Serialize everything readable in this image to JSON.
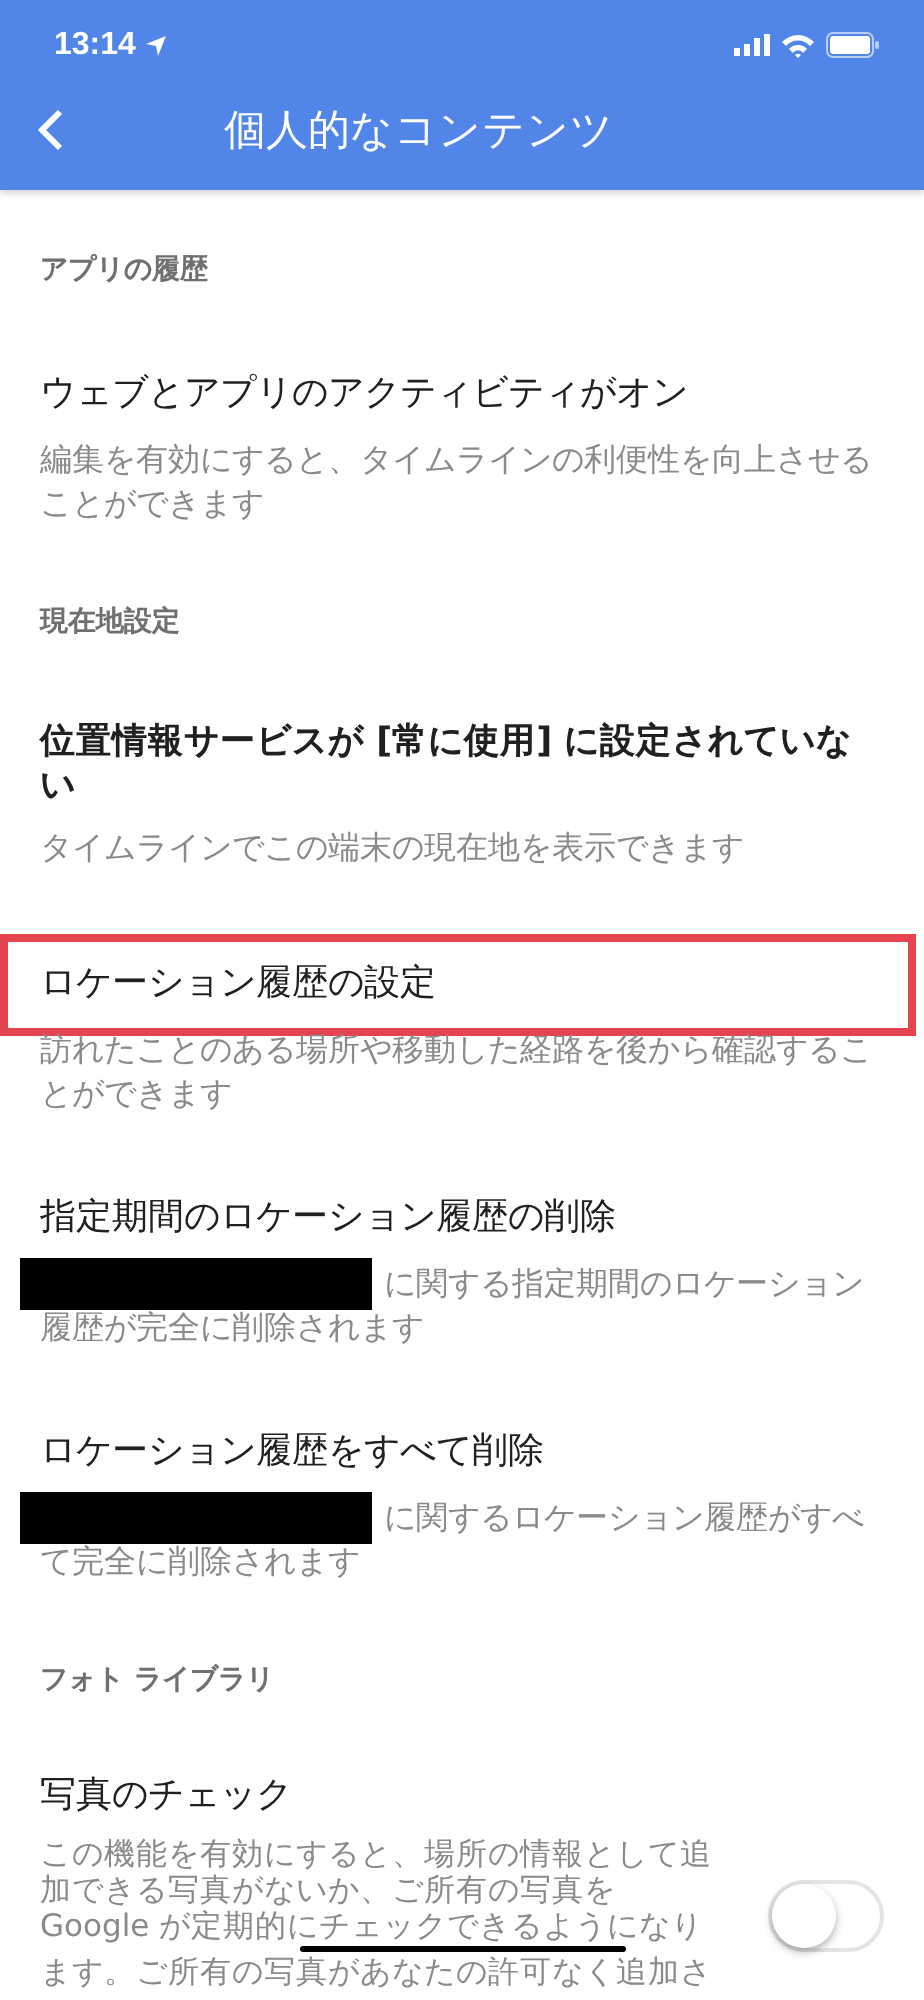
{
  "status_bar": {
    "time": "13:14"
  },
  "nav": {
    "title": "個人的なコンテンツ"
  },
  "sections": [
    {
      "header": "アプリの履歴",
      "items": [
        {
          "kind": "text",
          "title": "ウェブとアプリのアクティビティがオン",
          "bold": false,
          "highlighted": false,
          "description": "編集を有効にすると、タイムラインの利便性を向上させることができます"
        }
      ]
    },
    {
      "header": "現在地設定",
      "items": [
        {
          "kind": "text",
          "title": "位置情報サービスが [常に使用] に設定されていない",
          "bold": true,
          "highlighted": false,
          "description": "タイムラインでこの端末の現在地を表示できます"
        },
        {
          "kind": "text",
          "title": "ロケーション履歴の設定",
          "bold": false,
          "highlighted": true,
          "description": "訪れたことのある場所や移動した経路を後から確認することができます"
        },
        {
          "kind": "redacted",
          "title": "指定期間のロケーション履歴の削除",
          "bold": false,
          "highlighted": false,
          "description": [
            "に関する指定期間のロケーション",
            "履歴が完全に削除されます"
          ]
        },
        {
          "kind": "redacted",
          "title": "ロケーション履歴をすべて削除",
          "bold": false,
          "highlighted": false,
          "description": [
            "に関するロケーション履歴がすべ",
            "て完全に削除されます"
          ]
        }
      ]
    },
    {
      "header": "フォト ライブラリ",
      "items": [
        {
          "kind": "toggle",
          "title": "写真のチェック",
          "bold": false,
          "highlighted": false,
          "on": false,
          "description": [
            "この機能を有効にすると、場所の情報として追",
            "加できる写真がないか、ご所有の写真を",
            "Google が定期的にチェックできるようになり",
            "ます。ご所有の写真があなたの許可なく追加さ"
          ]
        }
      ]
    }
  ]
}
